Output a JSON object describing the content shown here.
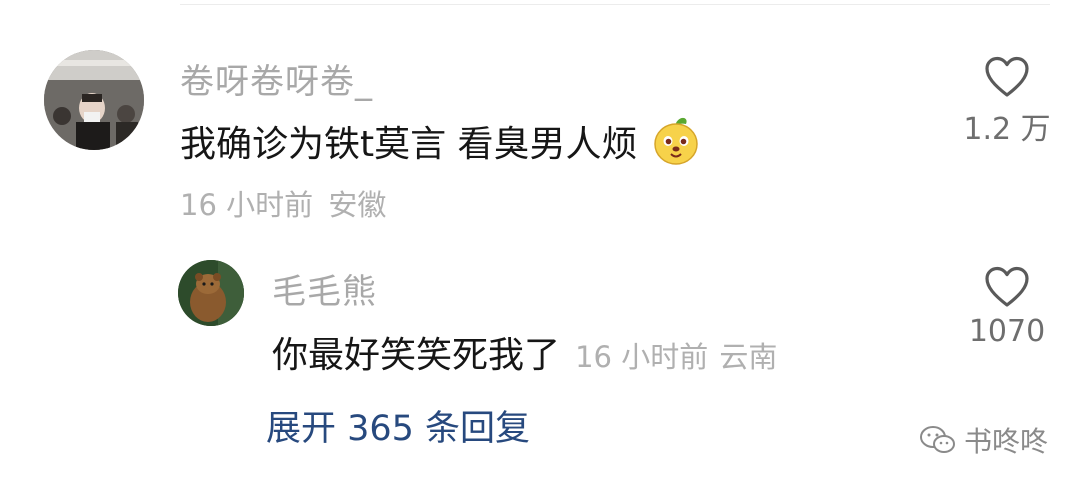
{
  "comment": {
    "username": "卷呀卷呀卷_",
    "text": "我确诊为铁t莫言 看臭男人烦",
    "emoji_icon": "mango-face-emoji",
    "time": "16 小时前",
    "location": "安徽",
    "like_count": "1.2 万"
  },
  "reply": {
    "username": "毛毛熊",
    "text": "你最好笑笑死我了",
    "time": "16 小时前",
    "location": "云南",
    "like_count": "1070"
  },
  "expand_replies_label": "展开 365 条回复",
  "watermark": {
    "icon": "wechat-icon",
    "text": "书咚咚"
  }
}
